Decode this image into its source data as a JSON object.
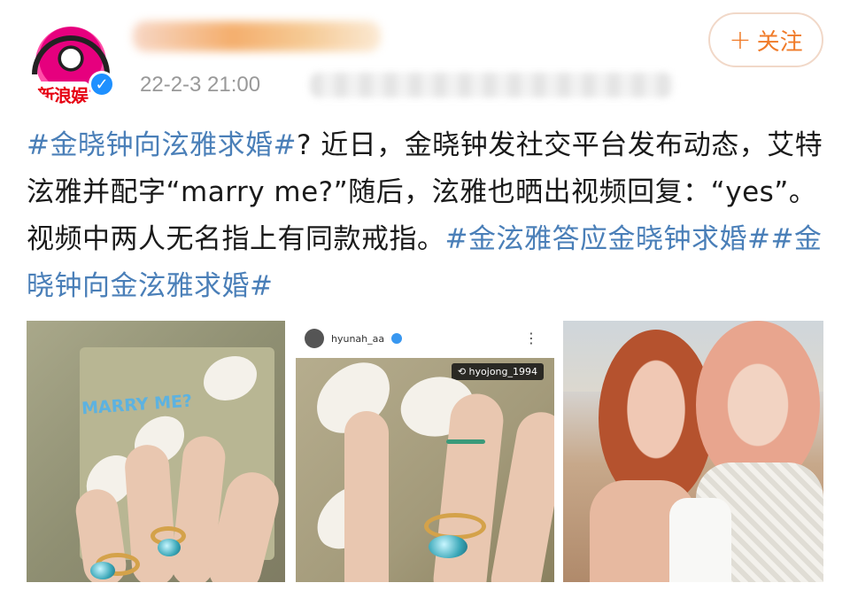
{
  "post": {
    "author_avatar_label": "新浪娱",
    "timestamp": "22-2-3 21:00",
    "follow_button": {
      "icon": "plus-icon",
      "label": "关注"
    },
    "text_segments": [
      {
        "text": "#金晓钟向泫雅求婚#",
        "kind": "hashtag"
      },
      {
        "text": "? 近日，金晓钟发社交平台发布动态，艾特泫雅并配字“marry me?”随后，泫雅也晒出视频回复：“yes”。视频中两人无名指上有同款戒指。",
        "kind": "plain"
      },
      {
        "text": "#金泫雅答应金晓钟求婚#",
        "kind": "hashtag"
      },
      {
        "text": "#金晓钟向金泫雅求婚#",
        "kind": "hashtag"
      }
    ],
    "colors": {
      "hashtag": "#4a7fb8",
      "follow_accent": "#f07b29",
      "time": "#999999"
    },
    "images": [
      {
        "name": "ring-photo-1",
        "overlay_text": "MARRY ME?"
      },
      {
        "name": "ring-photo-2",
        "account": "hyunah_aa",
        "repost_account": "hyojong_1994"
      },
      {
        "name": "couple-photo"
      }
    ]
  }
}
